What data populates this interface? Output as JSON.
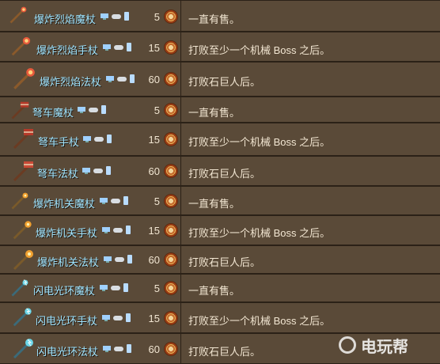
{
  "rows": [
    {
      "name": "爆炸烈焰魔杖",
      "price": "5",
      "condition": "一直有售。",
      "icon": "staff-flame-icon"
    },
    {
      "name": "爆炸烈焰手杖",
      "price": "15",
      "condition": "打败至少一个机械 Boss 之后。",
      "icon": "staff-flame-icon"
    },
    {
      "name": "爆炸烈焰法杖",
      "price": "60",
      "condition": "打败石巨人后。",
      "icon": "staff-flame-icon"
    },
    {
      "name": "弩车魔杖",
      "price": "5",
      "condition": "一直有售。",
      "icon": "staff-ballista-icon"
    },
    {
      "name": "弩车手杖",
      "price": "15",
      "condition": "打败至少一个机械 Boss 之后。",
      "icon": "staff-ballista-icon"
    },
    {
      "name": "弩车法杖",
      "price": "60",
      "condition": "打败石巨人后。",
      "icon": "staff-ballista-icon"
    },
    {
      "name": "爆炸机关魔杖",
      "price": "5",
      "condition": "一直有售。",
      "icon": "staff-explosive-icon"
    },
    {
      "name": "爆炸机关手杖",
      "price": "15",
      "condition": "打败至少一个机械 Boss 之后。",
      "icon": "staff-explosive-icon"
    },
    {
      "name": "爆炸机关法杖",
      "price": "60",
      "condition": "打败石巨人后。",
      "icon": "staff-explosive-icon"
    },
    {
      "name": "闪电光环魔杖",
      "price": "5",
      "condition": "一直有售。",
      "icon": "staff-lightning-icon"
    },
    {
      "name": "闪电光环手杖",
      "price": "15",
      "condition": "打败至少一个机械 Boss 之后。",
      "icon": "staff-lightning-icon"
    },
    {
      "name": "闪电光环法杖",
      "price": "60",
      "condition": "打败石巨人后。",
      "icon": "staff-lightning-icon"
    }
  ],
  "platform_icons": [
    "pc-icon",
    "console-icon",
    "mobile-icon"
  ],
  "currency_icon": "defender-medal-icon",
  "watermark": {
    "text": "电玩帮",
    "icon": "watermark-logo-icon"
  },
  "colors": {
    "name": "#9fe4ff",
    "text": "#f2e6d2",
    "row_bg": "#5a4a38",
    "border": "#2b2117"
  }
}
